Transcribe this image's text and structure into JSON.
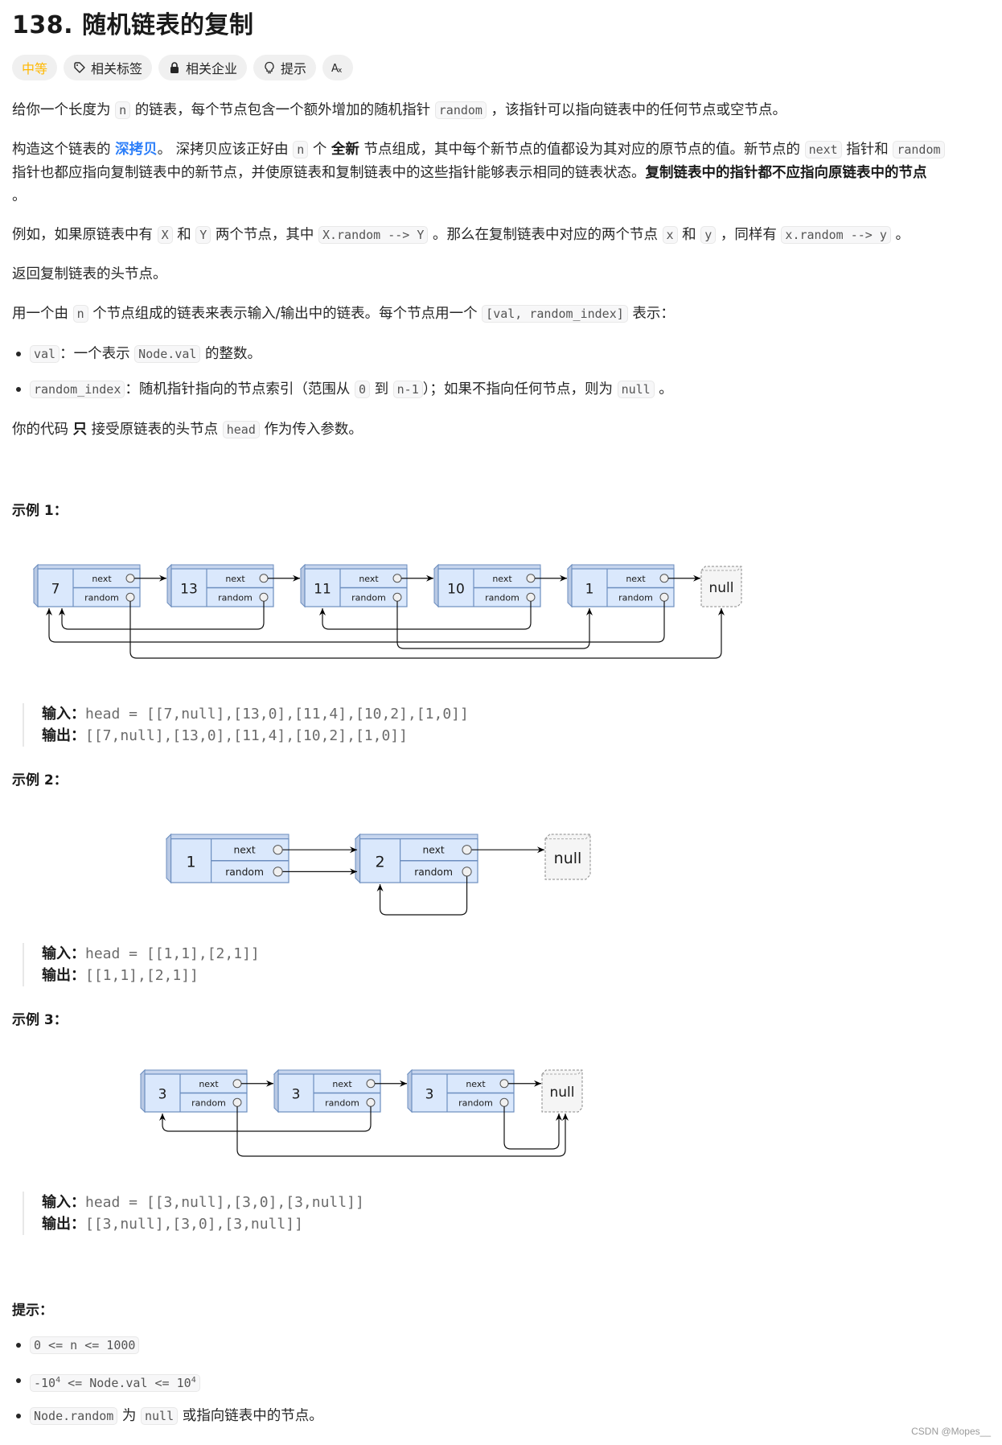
{
  "title": "138. 随机链表的复制",
  "tags": [
    {
      "label": "中等",
      "icon": null
    },
    {
      "label": "相关标签",
      "icon": "tag-icon"
    },
    {
      "label": "相关企业",
      "icon": "lock-icon"
    },
    {
      "label": "提示",
      "icon": "lightbulb-icon"
    },
    {
      "label": "Aあ",
      "icon": "translate-icon"
    }
  ],
  "colors": {
    "difficulty": "#ffb800",
    "link": "#2d7ff9",
    "node_fill": "#dae8fc",
    "node_stroke": "#6c8ebf",
    "null_fill": "#f5f5f5"
  },
  "para1": {
    "a": "给你一个长度为",
    "c1": "n",
    "b": "的链表，每个节点包含一个额外增加的随机指针",
    "c2": "random",
    "d": "，该指针可以指向链表中的任何节点或空节点。"
  },
  "para2": {
    "a": "构造这个链表的",
    "link": "深拷贝",
    "b": "。 深拷贝应该正好由",
    "c1": "n",
    "c": "个",
    "bold1": "全新",
    "d": "节点组成，其中每个新节点的值都设为其对应的原节点的值。新节点的",
    "c2": "next",
    "e": "指针和",
    "c3": "random",
    "line2": "指针也都应指向复制链表中的新节点，并使原链表和复制链表中的这些指针能够表示相同的链表状态。",
    "bold2": "复制链表中的指针都不应指向原链表中的节点",
    "line3": "。"
  },
  "para3": {
    "a": "例如，如果原链表中有",
    "c1": "X",
    "b": "和",
    "c2": "Y",
    "c": "两个节点，其中",
    "c3": "X.random --> Y",
    "d": "。那么在复制链表中对应的两个节点",
    "c4": "x",
    "e": "和",
    "c5": "y",
    "f": "，同样有",
    "c6": "x.random --> y",
    "g": "。"
  },
  "para4": "返回复制链表的头节点。",
  "para5": {
    "a": "用一个由",
    "c1": "n",
    "b": "个节点组成的链表来表示输入/输出中的链表。每个节点用一个",
    "c2": "[val, random_index]",
    "c": "表示："
  },
  "bullets": [
    {
      "c1": "val",
      "a": "：一个表示",
      "c2": "Node.val",
      "b": "的整数。"
    },
    {
      "c1": "random_index",
      "a": "：随机指针指向的节点索引（范围从",
      "c2": "0",
      "b": "到",
      "c3": "n-1",
      "c": "）；如果不指向任何节点，则为",
      "c4": "null",
      "d": "。"
    }
  ],
  "para6": {
    "a": "你的代码",
    "bold": "只",
    "b": "接受原链表的头节点",
    "c1": "head",
    "c": "作为传入参数。"
  },
  "examples": [
    {
      "heading": "示例 1：",
      "input_label": "输入：",
      "input": "head = [[7,null],[13,0],[11,4],[10,2],[1,0]]",
      "output_label": "输出：",
      "output": "[[7,null],[13,0],[11,4],[10,2],[1,0]]",
      "nodes": [
        "7",
        "13",
        "11",
        "10",
        "1"
      ],
      "random": [
        null,
        0,
        4,
        2,
        0
      ]
    },
    {
      "heading": "示例 2：",
      "input_label": "输入：",
      "input": "head = [[1,1],[2,1]]",
      "output_label": "输出：",
      "output": "[[1,1],[2,1]]",
      "nodes": [
        "1",
        "2"
      ],
      "random": [
        1,
        1
      ]
    },
    {
      "heading": "示例 3：",
      "input_label": "输入：",
      "input": "head = [[3,null],[3,0],[3,null]]",
      "output_label": "输出：",
      "output": "[[3,null],[3,0],[3,null]]",
      "nodes": [
        "3",
        "3",
        "3"
      ],
      "random": [
        null,
        0,
        null
      ]
    }
  ],
  "diagram_labels": {
    "next": "next",
    "random": "random",
    "null": "null"
  },
  "hints": {
    "heading": "提示：",
    "items": [
      {
        "code": "0 <= n <= 1000"
      },
      {
        "code_a": "-10",
        "sup1": "4",
        "code_b": " <= Node.val <= 10",
        "sup2": "4"
      },
      {
        "c1": "Node.random",
        "a": "为",
        "c2": "null",
        "b": "或指向链表中的节点。"
      }
    ]
  },
  "watermark": "CSDN @Mopes__"
}
